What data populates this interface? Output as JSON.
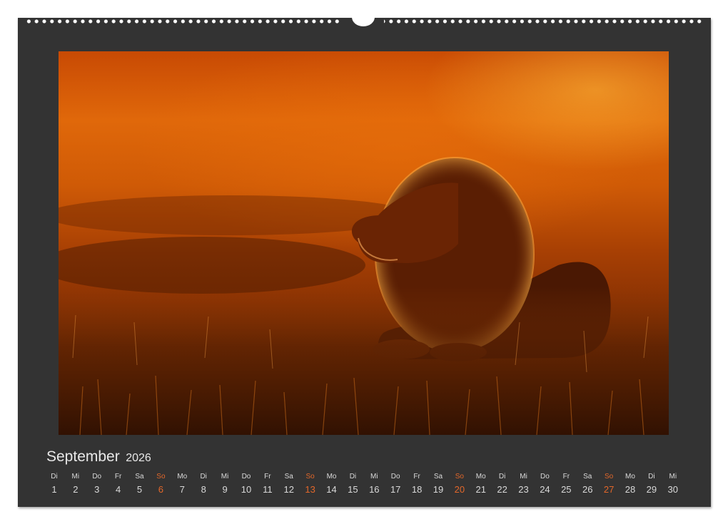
{
  "calendar": {
    "month": "September",
    "year": "2026",
    "photo": {
      "subject": "lion-icon"
    },
    "days": [
      {
        "wd": "Di",
        "num": "1",
        "sunday": false
      },
      {
        "wd": "Mi",
        "num": "2",
        "sunday": false
      },
      {
        "wd": "Do",
        "num": "3",
        "sunday": false
      },
      {
        "wd": "Fr",
        "num": "4",
        "sunday": false
      },
      {
        "wd": "Sa",
        "num": "5",
        "sunday": false
      },
      {
        "wd": "So",
        "num": "6",
        "sunday": true
      },
      {
        "wd": "Mo",
        "num": "7",
        "sunday": false
      },
      {
        "wd": "Di",
        "num": "8",
        "sunday": false
      },
      {
        "wd": "Mi",
        "num": "9",
        "sunday": false
      },
      {
        "wd": "Do",
        "num": "10",
        "sunday": false
      },
      {
        "wd": "Fr",
        "num": "11",
        "sunday": false
      },
      {
        "wd": "Sa",
        "num": "12",
        "sunday": false
      },
      {
        "wd": "So",
        "num": "13",
        "sunday": true
      },
      {
        "wd": "Mo",
        "num": "14",
        "sunday": false
      },
      {
        "wd": "Di",
        "num": "15",
        "sunday": false
      },
      {
        "wd": "Mi",
        "num": "16",
        "sunday": false
      },
      {
        "wd": "Do",
        "num": "17",
        "sunday": false
      },
      {
        "wd": "Fr",
        "num": "18",
        "sunday": false
      },
      {
        "wd": "Sa",
        "num": "19",
        "sunday": false
      },
      {
        "wd": "So",
        "num": "20",
        "sunday": true
      },
      {
        "wd": "Mo",
        "num": "21",
        "sunday": false
      },
      {
        "wd": "Di",
        "num": "22",
        "sunday": false
      },
      {
        "wd": "Mi",
        "num": "23",
        "sunday": false
      },
      {
        "wd": "Do",
        "num": "24",
        "sunday": false
      },
      {
        "wd": "Fr",
        "num": "25",
        "sunday": false
      },
      {
        "wd": "Sa",
        "num": "26",
        "sunday": false
      },
      {
        "wd": "So",
        "num": "27",
        "sunday": true
      },
      {
        "wd": "Mo",
        "num": "28",
        "sunday": false
      },
      {
        "wd": "Di",
        "num": "29",
        "sunday": false
      },
      {
        "wd": "Mi",
        "num": "30",
        "sunday": false
      }
    ],
    "colors": {
      "background": "#333333",
      "text": "#d9d9d9",
      "sunday": "#e2672a"
    }
  }
}
